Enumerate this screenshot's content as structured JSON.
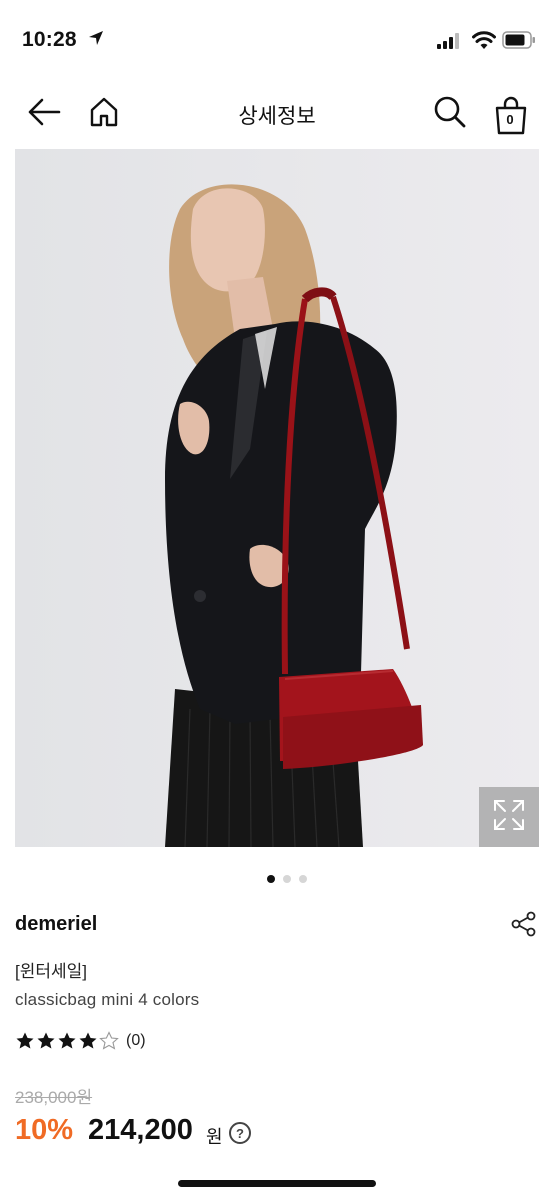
{
  "status": {
    "time": "10:28"
  },
  "nav": {
    "title": "상세정보",
    "cart_count": "0"
  },
  "product": {
    "brand": "demeriel",
    "tag": "[윈터세일]",
    "name": "classicbag mini 4 colors",
    "rating": {
      "stars": 4,
      "max": 5,
      "count_label": "(0)"
    },
    "original_price": "238,000원",
    "discount": "10%",
    "price": "214,200",
    "currency": "원",
    "help_label": "?"
  },
  "gallery": {
    "total": 3,
    "active": 0
  },
  "colors": {
    "accent": "#f06b25",
    "text": "#111111",
    "muted": "#aaaaaa",
    "bag": "#a3141c"
  },
  "icons": [
    "location-arrow-icon",
    "signal-icon",
    "wifi-icon",
    "battery-icon",
    "back-arrow-icon",
    "home-icon",
    "search-icon",
    "shopping-bag-icon",
    "expand-icon",
    "share-icon",
    "star-icon",
    "help-icon"
  ]
}
